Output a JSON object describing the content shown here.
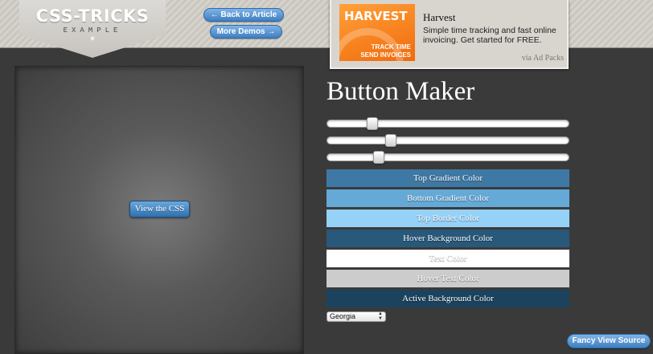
{
  "header": {
    "logo_title": "CSS-TRICKS",
    "logo_subtitle": "EXAMPLE",
    "logo_star": "*",
    "back_link": "← Back to Article",
    "more_demos": "More Demos →"
  },
  "ad": {
    "image_title": "HARVEST",
    "image_line1": "TRACK TIME",
    "image_line2": "SEND INVOICES",
    "title": "Harvest",
    "description": "Simple time tracking and fast online invoicing. Get started for FREE.",
    "via": "via Ad Packs"
  },
  "preview": {
    "button_label": "View the CSS"
  },
  "maker": {
    "title": "Button Maker",
    "sliders": [
      {
        "name": "slider-1",
        "value_fraction": 0.17
      },
      {
        "name": "slider-2",
        "value_fraction": 0.25
      },
      {
        "name": "slider-3",
        "value_fraction": 0.2
      }
    ],
    "color_options": [
      {
        "label": "Top Gradient Color",
        "color": "#3e79a6"
      },
      {
        "label": "Bottom Gradient Color",
        "color": "#65a9d7"
      },
      {
        "label": "Top Border Color",
        "color": "#96d1f8"
      },
      {
        "label": "Hover Background Color",
        "color": "#28597a"
      },
      {
        "label": "Text Color",
        "color": "#ffffff"
      },
      {
        "label": "Hover Text Color",
        "color": "#cccccc"
      },
      {
        "label": "Active Background Color",
        "color": "#1b435e"
      }
    ],
    "font_select": "Georgia",
    "fancy_button": "Fancy View Source"
  }
}
